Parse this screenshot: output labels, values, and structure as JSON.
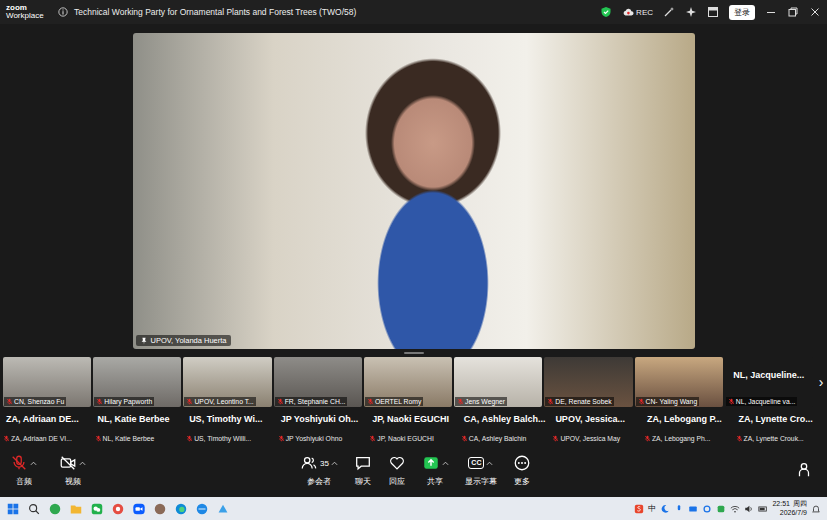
{
  "window": {
    "app": "zoom",
    "app_sub": "Workplace",
    "title": "Technical Working Party for Ornamental Plants and Forest Trees (TWO/58)",
    "rec": "REC",
    "login": "登录"
  },
  "speaker": {
    "name": "UPOV, Yolanda Huerta",
    "pinned": true
  },
  "gallery": [
    {
      "kind": "video",
      "name": "CN, Shenzao Fu",
      "muted": true
    },
    {
      "kind": "video",
      "name": "Hilary Papworth",
      "muted": true
    },
    {
      "kind": "video",
      "name": "UPOV, Leontino T...",
      "muted": true
    },
    {
      "kind": "video",
      "name": "FR, Stephanie CH...",
      "muted": true
    },
    {
      "kind": "video",
      "name": "OERTEL Romy",
      "muted": true
    },
    {
      "kind": "video",
      "name": "Jens Wegner",
      "muted": true
    },
    {
      "kind": "video",
      "name": "DE, Renate Sobek",
      "muted": true
    },
    {
      "kind": "video",
      "name": "CN- Yaling Wang",
      "muted": true
    },
    {
      "kind": "avatar",
      "display": "NL, Jacqueline...",
      "name": "NL, Jacqueline va...",
      "muted": true
    }
  ],
  "gallery_nav": "›",
  "name_tiles": [
    {
      "display": "ZA, Adriaan DE...",
      "name": "ZA, Adriaan DE VI...",
      "muted": true
    },
    {
      "display": "NL, Katie Berbee",
      "name": "NL, Katie Berbee",
      "muted": true
    },
    {
      "display": "US, Timothy Wi...",
      "name": "US, Timothy Willi...",
      "muted": true
    },
    {
      "display": "JP Yoshiyuki Oh...",
      "name": "JP Yoshiyuki Ohno",
      "muted": true
    },
    {
      "display": "JP, Naoki EGUCHI",
      "name": "JP, Naoki EGUCHI",
      "muted": true
    },
    {
      "display": "CA, Ashley Balch...",
      "name": "CA, Ashley Balchin",
      "muted": true
    },
    {
      "display": "UPOV, Jessica...",
      "name": "UPOV, Jessica May",
      "muted": true
    },
    {
      "display": "ZA, Lebogang P...",
      "name": "ZA, Lebogang Ph...",
      "muted": true
    },
    {
      "display": "ZA, Lynette Cro...",
      "name": "ZA, Lynette Crouk...",
      "muted": true
    }
  ],
  "toolbar": {
    "audio": {
      "label": "音频",
      "muted": true
    },
    "video": {
      "label": "视频",
      "off": true
    },
    "participants": {
      "label": "参会者",
      "count": "35"
    },
    "chat": {
      "label": "聊天"
    },
    "reactions": {
      "label": "回应"
    },
    "share": {
      "label": "共享"
    },
    "captions": {
      "label": "显示字幕",
      "icon": "CC"
    },
    "more": {
      "label": "更多"
    }
  },
  "taskbar": {
    "ime": "中",
    "time": "22:51",
    "weekday": "周四",
    "date": "2026/7/9"
  }
}
